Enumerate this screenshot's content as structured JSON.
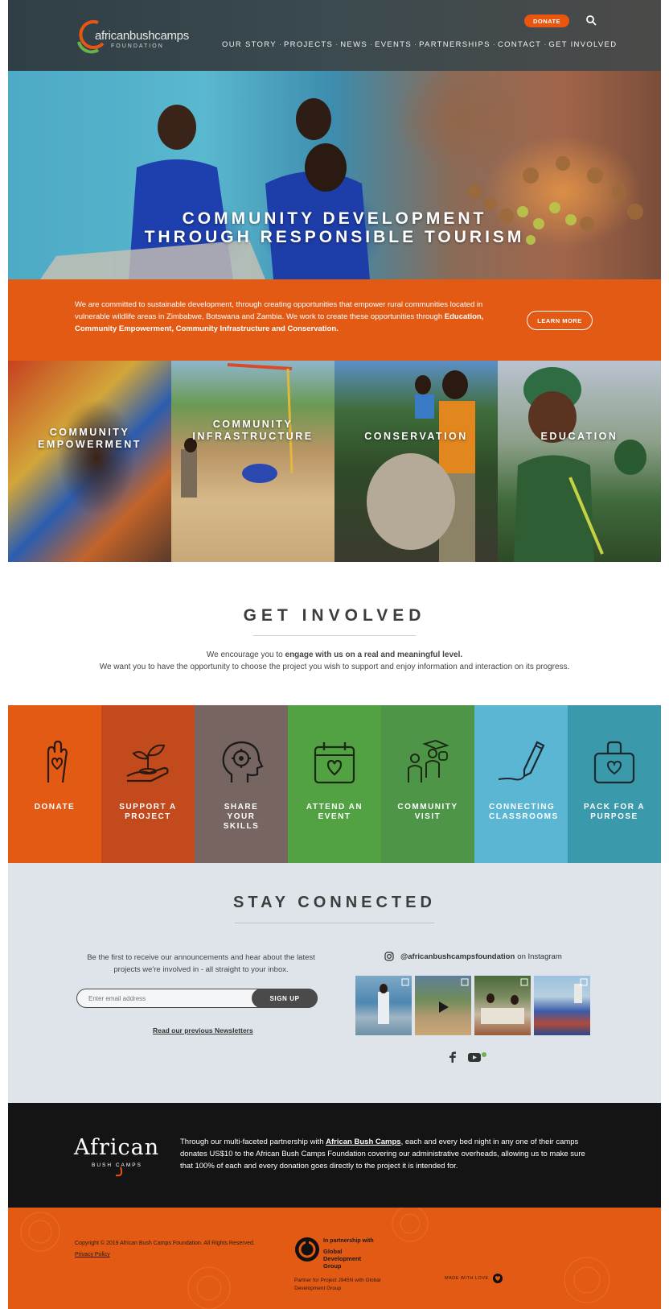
{
  "header": {
    "logo_text": "africanbushcamps",
    "logo_subtext": "FOUNDATION",
    "donate_label": "DONATE",
    "search_icon": "search-icon",
    "nav": [
      "OUR STORY",
      "PROJECTS",
      "NEWS",
      "EVENTS",
      "PARTNERSHIPS",
      "CONTACT",
      "GET INVOLVED"
    ]
  },
  "hero": {
    "title_line1": "COMMUNITY DEVELOPMENT",
    "title_line2": "THROUGH RESPONSIBLE TOURISM"
  },
  "commitment": {
    "text_plain": "We are committed to sustainable development, through creating opportunities that empower rural communities located in vulnerable wildlife areas in Zimbabwe, Botswana and Zambia. We work to create these opportunities through ",
    "text_bold": "Education, Community Empowerment, Community Infrastructure and Conservation.",
    "learn_more": "LEARN MORE"
  },
  "tiles": [
    {
      "label_line1": "COMMUNITY",
      "label_line2": "EMPOWERMENT"
    },
    {
      "label_line1": "COMMUNITY",
      "label_line2": "INFRASTRUCTURE"
    },
    {
      "label_line1": "CONSERVATION",
      "label_line2": ""
    },
    {
      "label_line1": "EDUCATION",
      "label_line2": ""
    }
  ],
  "get_involved": {
    "title": "GET INVOLVED",
    "p1_plain": "We encourage you to ",
    "p1_bold": "engage with us on a real and meaningful level.",
    "p2": "We want you to have the opportunity to choose the project you wish to support and enjoy information and interaction on its progress."
  },
  "actions": [
    {
      "label": "DONATE",
      "icon": "heart-hand-icon",
      "color": "#e35a14"
    },
    {
      "label": "SUPPORT A PROJECT",
      "icon": "plant-in-hand-icon",
      "color": "#c24a1c"
    },
    {
      "label": "SHARE YOUR SKILLS",
      "icon": "head-gear-icon",
      "color": "#766560"
    },
    {
      "label": "ATTEND AN EVENT",
      "icon": "calendar-heart-icon",
      "color": "#52a243"
    },
    {
      "label": "COMMUNITY VISIT",
      "icon": "people-icon",
      "color": "#4e9547"
    },
    {
      "label": "CONNECTING CLASSROOMS",
      "icon": "pencil-icon",
      "color": "#5bb6d3"
    },
    {
      "label": "PACK FOR A PURPOSE",
      "icon": "suitcase-heart-icon",
      "color": "#3a99aa"
    }
  ],
  "stay_connected": {
    "title": "STAY CONNECTED",
    "paragraph_line1": "Be the first to receive our announcements and hear about the latest",
    "paragraph_line2": "projects we're involved in - all straight to your inbox.",
    "email_placeholder": "Enter email address",
    "signup_label": "SIGN UP",
    "newsletters_link": "Read our previous Newsletters",
    "instagram_handle": "@africanbushcampsfoundation",
    "instagram_suffix": "on Instagram"
  },
  "footer_dark": {
    "logo_text": "African",
    "logo_subtext": "BUSH CAMPS",
    "text_before": "Through our multi-faceted partnership with ",
    "text_link": "African Bush Camps",
    "text_after": ", each and every bed night in any one of their camps donates US$10 to the African Bush Camps Foundation covering our administrative overheads, allowing us to make sure that 100% of each and every donation goes directly to the project it is intended for."
  },
  "footer_orange": {
    "copyright": "Copyright © 2019 African Bush Camps Foundation. All Rights Reserved.",
    "privacy": "Privacy Policy",
    "in_partnership": "In partnership with",
    "gdg_name": "Global Development Group",
    "partner_text": "Partner for Project J945N with Global Development Group",
    "made_with": "MADE WITH LOVE"
  }
}
